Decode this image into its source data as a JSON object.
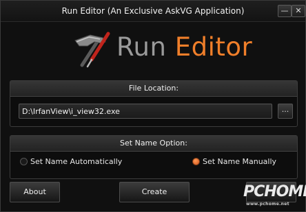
{
  "window": {
    "title": "Run Editor (An Exclusive AskVG Application)",
    "minimize_label": "—",
    "close_label": "✕"
  },
  "logo": {
    "word1": "Run",
    "word2": "Editor",
    "icon": "hammer-icon"
  },
  "file_location": {
    "header": "File Location:",
    "path_value": "D:\\IrfanView\\i_view32.exe",
    "browse_label": "..."
  },
  "set_name": {
    "header": "Set Name Option:",
    "options": [
      {
        "label": "Set Name Automatically",
        "selected": false
      },
      {
        "label": "Set Name Manually",
        "selected": true
      }
    ]
  },
  "buttons": {
    "about": "About",
    "create": "Create"
  },
  "watermark": {
    "main": "PCHOME",
    "sub": "www.pchome.net"
  },
  "colors": {
    "accent": "#f07f2a",
    "radio_selected": "#e06a2a",
    "background": "#101010"
  }
}
